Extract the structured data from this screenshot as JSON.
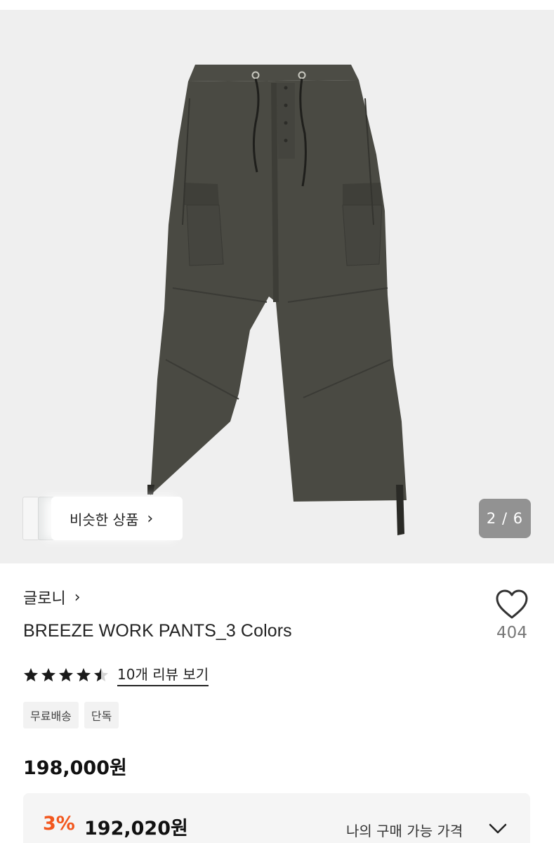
{
  "gallery": {
    "similar_label": "비슷한 상품",
    "similar_chevron": "›",
    "page_indicator": "2 / 6"
  },
  "product": {
    "brand": "글로니",
    "brand_chevron": "›",
    "name": "BREEZE WORK PANTS_3 Colors",
    "like_count": "404",
    "rating_stars": 4.5,
    "review_link": "10개 리뷰 보기",
    "tags": [
      "무료배송",
      "단독"
    ],
    "price": "198,000원",
    "discount": {
      "rate": "3%",
      "price": "192,020원",
      "purchase_label": "나의 구매 가능 가격"
    }
  },
  "icons": {
    "like": "heart-outline-icon",
    "star": "star-icon",
    "dropdown": "chevron-down-icon"
  },
  "colors": {
    "pants": "#4a4a43",
    "discount_accent": "#f2571e",
    "gallery_bg": "#efefef"
  }
}
